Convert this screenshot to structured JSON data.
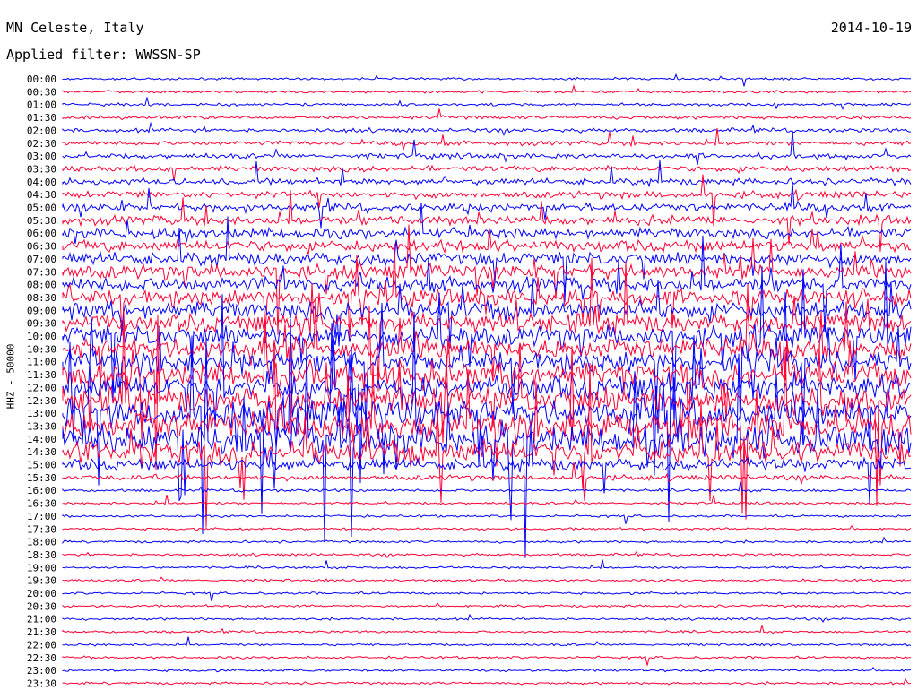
{
  "header": {
    "station": "MN Celeste, Italy",
    "filter": "Applied filter: WWSSN-SP",
    "date": "2014-10-19"
  },
  "chart_data": {
    "type": "line",
    "title": "MN Celeste, Italy",
    "subtitle": "Applied filter: WWSSN-SP",
    "date": "2014-10-19",
    "ylabel": "HHZ - 50000",
    "row_labels": [
      "00:00",
      "00:30",
      "01:00",
      "01:30",
      "02:00",
      "02:30",
      "03:00",
      "03:30",
      "04:00",
      "04:30",
      "05:00",
      "05:30",
      "06:00",
      "06:30",
      "07:00",
      "07:30",
      "08:00",
      "08:30",
      "09:00",
      "09:30",
      "10:00",
      "10:30",
      "11:00",
      "11:30",
      "12:00",
      "12:30",
      "13:00",
      "13:30",
      "14:00",
      "14:30",
      "15:00",
      "15:30",
      "16:00",
      "16:30",
      "17:00",
      "17:30",
      "18:00",
      "18:30",
      "19:00",
      "19:30",
      "20:00",
      "20:30",
      "21:00",
      "21:30",
      "22:00",
      "22:30",
      "23:00",
      "23:30"
    ],
    "series_colors": [
      "#0000ff",
      "#ff0033"
    ],
    "relative_amplitude": [
      0.4,
      0.45,
      0.5,
      0.6,
      0.7,
      0.8,
      0.9,
      1.0,
      1.1,
      1.2,
      1.4,
      1.6,
      1.8,
      2.0,
      2.2,
      2.4,
      2.6,
      2.8,
      3.0,
      3.2,
      3.4,
      3.6,
      3.8,
      4.0,
      4.2,
      4.4,
      4.6,
      4.8,
      5.0,
      4.0,
      2.0,
      0.9,
      0.5,
      0.45,
      0.42,
      0.42,
      0.42,
      0.42,
      0.42,
      0.42,
      0.42,
      0.42,
      0.42,
      0.42,
      0.42,
      0.42,
      0.42,
      0.42
    ],
    "grid": false
  }
}
